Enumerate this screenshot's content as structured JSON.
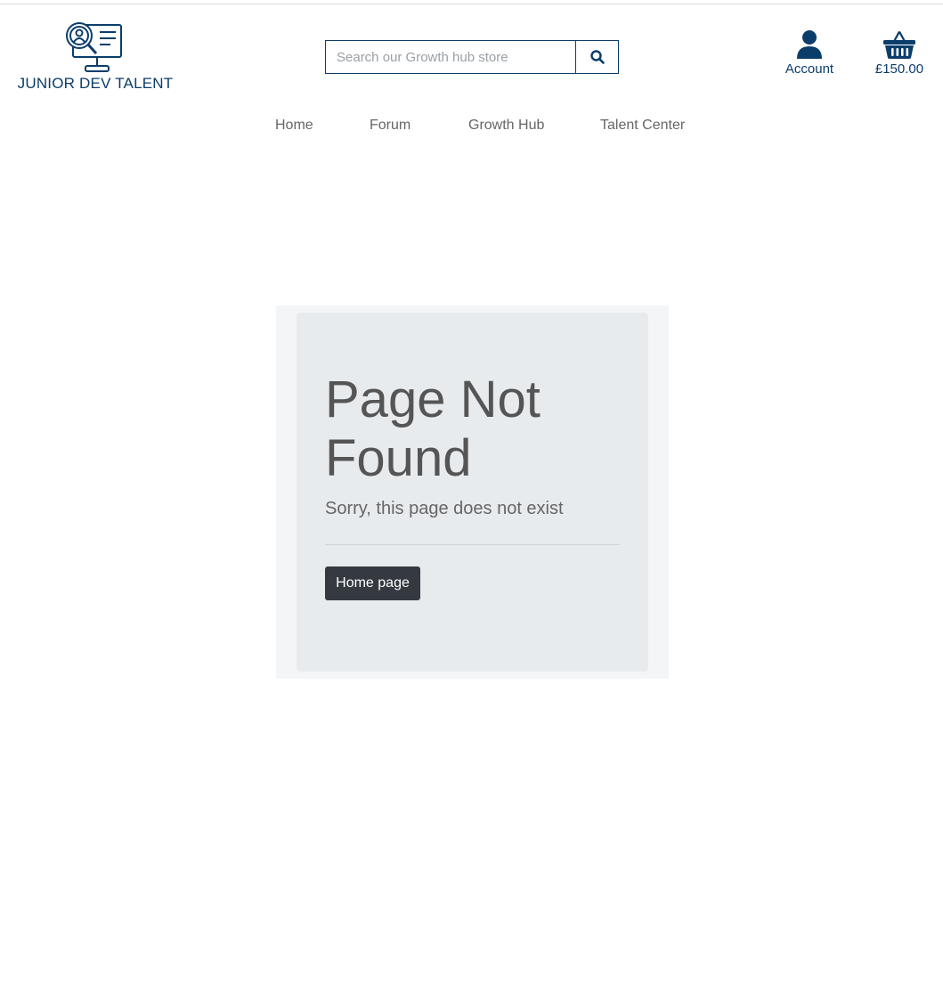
{
  "brand": {
    "name": "JUNIOR DEV TALENT",
    "logo_icon": "monitor-magnifier-person-icon",
    "color": "#0b3d6b"
  },
  "search": {
    "placeholder": "Search our Growth hub store",
    "value": "",
    "button_icon": "search-icon"
  },
  "account": {
    "label": "Account",
    "icon": "user-icon"
  },
  "basket": {
    "total": "£150.00",
    "icon": "basket-icon"
  },
  "nav": {
    "items": [
      {
        "label": "Home"
      },
      {
        "label": "Forum"
      },
      {
        "label": "Growth Hub"
      },
      {
        "label": "Talent Center"
      }
    ]
  },
  "error": {
    "title": "Page Not Found",
    "message": "Sorry, this page does not exist",
    "button_label": "Home page"
  },
  "colors": {
    "accent": "#0b3d6b",
    "button_bg": "#343a40",
    "panel_bg": "#e8ebee"
  }
}
